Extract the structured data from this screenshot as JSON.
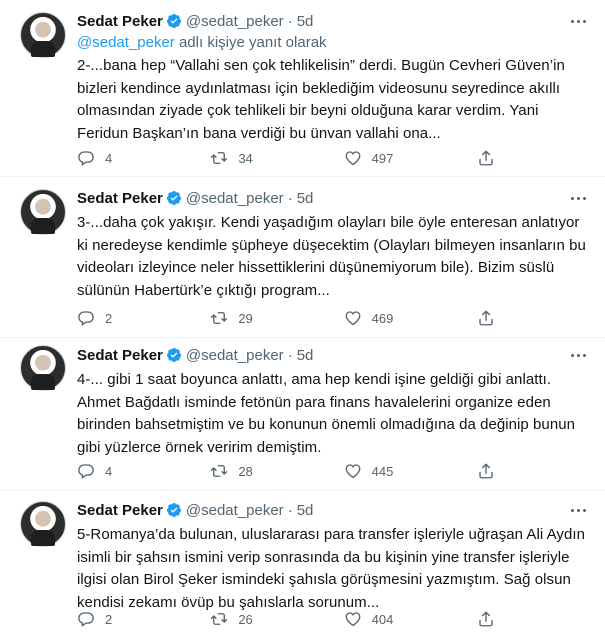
{
  "tweets": [
    {
      "author": "Sedat Peker",
      "handle": "@sedat_peker",
      "dot": "·",
      "time": "5d",
      "reply_to_mention": "@sedat_peker",
      "reply_to_suffix": " adlı kişiye yanıt olarak",
      "text": "2-...bana hep “Vallahi sen çok tehlikelisin” derdi. Bugün Cevheri Güven’in bizleri kendince aydınlatması için beklediğim videosunu seyredince akıllı olmasından ziyade çok tehlikeli bir beyni olduğuna karar verdim. Yani Feridun Başkan’ın bana verdiği bu ünvan vallahi ona...",
      "replies": "4",
      "retweets": "34",
      "likes": "497"
    },
    {
      "author": "Sedat Peker",
      "handle": "@sedat_peker",
      "dot": "·",
      "time": "5d",
      "text": "3-...daha çok yakışır. Kendi yaşadığım olayları bile öyle enteresan anlatıyor ki neredeyse kendimle şüpheye düşecektim (Olayları bilmeyen insanların bu videoları izleyince neler hissettiklerini düşünemiyorum bile). Bizim süslü sülünün Habertürk’e çıktığı program...",
      "replies": "2",
      "retweets": "29",
      "likes": "469"
    },
    {
      "author": "Sedat Peker",
      "handle": "@sedat_peker",
      "dot": "·",
      "time": "5d",
      "text": "4-... gibi 1 saat boyunca anlattı, ama hep kendi işine geldiği gibi anlattı. Ahmet Bağdatlı isminde fetönün para finans havalelerini organize eden birinden bahsetmiştim ve bu konunun önemli olmadığına da değinip bunun gibi yüzlerce örnek veririm demiştim.",
      "replies": "4",
      "retweets": "28",
      "likes": "445"
    },
    {
      "author": "Sedat Peker",
      "handle": "@sedat_peker",
      "dot": "·",
      "time": "5d",
      "text": "5-Romanya’da bulunan, uluslararası para transfer işleriyle uğraşan Ali Aydın isimli bir şahsın ismini verip sonrasında da bu kişinin yine transfer işleriyle ilgisi olan Birol Şeker ismindeki şahısla görüşmesini yazmıştım. Sağ olsun kendisi zekamı övüp bu şahıslarla sorunum...",
      "replies": "2",
      "retweets": "26",
      "likes": "404"
    }
  ],
  "colors": {
    "text": "#0f1419",
    "muted": "#536471",
    "link": "#1d9bf0",
    "verified": "#1d9bf0",
    "divider": "#eff3f4"
  },
  "icons": [
    "verified-badge-icon",
    "more-icon",
    "reply-icon",
    "retweet-icon",
    "like-icon",
    "share-icon"
  ]
}
